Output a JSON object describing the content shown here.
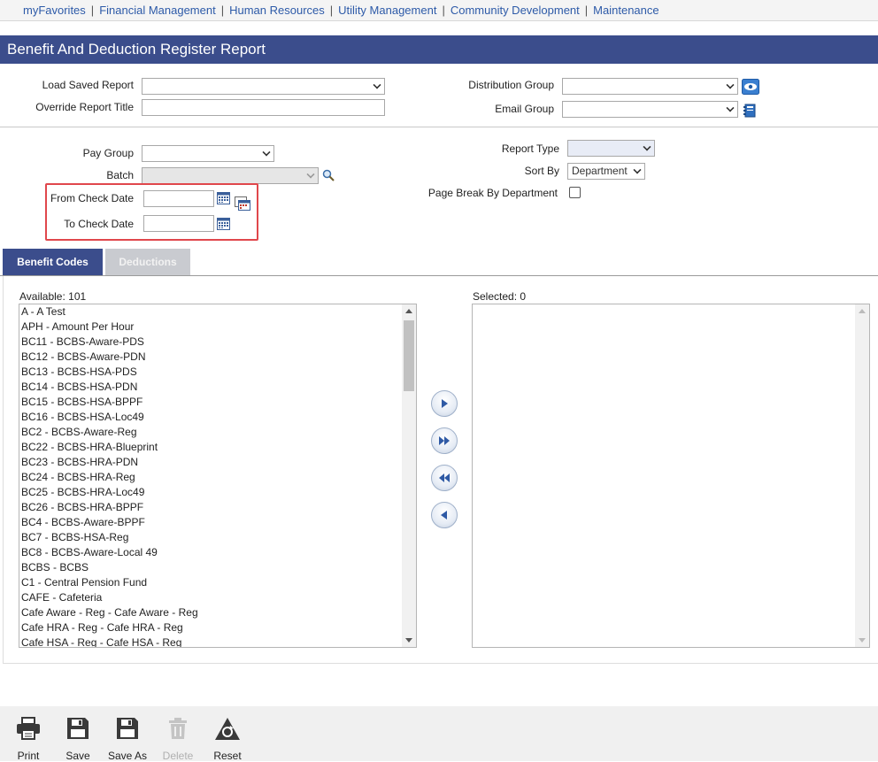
{
  "nav": {
    "items": [
      "myFavorites",
      "Financial Management",
      "Human Resources",
      "Utility Management",
      "Community Development",
      "Maintenance"
    ],
    "separator": "|"
  },
  "page": {
    "title": "Benefit And Deduction Register Report"
  },
  "header_form": {
    "load_saved_report": {
      "label": "Load Saved Report",
      "value": ""
    },
    "override_report_title": {
      "label": "Override Report Title",
      "value": ""
    },
    "distribution_group": {
      "label": "Distribution Group",
      "value": ""
    },
    "email_group": {
      "label": "Email Group",
      "value": ""
    }
  },
  "criteria": {
    "pay_group": {
      "label": "Pay Group",
      "value": ""
    },
    "batch": {
      "label": "Batch",
      "value": ""
    },
    "from_check_date": {
      "label": "From Check Date",
      "value": ""
    },
    "to_check_date": {
      "label": "To Check Date",
      "value": ""
    },
    "report_type": {
      "label": "Report Type",
      "value": ""
    },
    "sort_by": {
      "label": "Sort By",
      "value": "Department"
    },
    "page_break": {
      "label": "Page Break By Department",
      "checked": false
    }
  },
  "tabs": [
    {
      "label": "Benefit Codes",
      "active": true
    },
    {
      "label": "Deductions",
      "active": false
    }
  ],
  "available": {
    "label": "Available: 101",
    "items": [
      "A - A Test",
      "APH - Amount Per Hour",
      "BC11 - BCBS-Aware-PDS",
      "BC12 - BCBS-Aware-PDN",
      "BC13 - BCBS-HSA-PDS",
      "BC14 - BCBS-HSA-PDN",
      "BC15 - BCBS-HSA-BPPF",
      "BC16 - BCBS-HSA-Loc49",
      "BC2 - BCBS-Aware-Reg",
      "BC22 - BCBS-HRA-Blueprint",
      "BC23 - BCBS-HRA-PDN",
      "BC24 - BCBS-HRA-Reg",
      "BC25 - BCBS-HRA-Loc49",
      "BC26 - BCBS-HRA-BPPF",
      "BC4 - BCBS-Aware-BPPF",
      "BC7 - BCBS-HSA-Reg",
      "BC8 - BCBS-Aware-Local 49",
      "BCBS - BCBS",
      "C1 - Central Pension Fund",
      "CAFE - Cafeteria",
      "Cafe Aware - Reg - Cafe Aware - Reg",
      "Cafe HRA - Reg - Cafe HRA - Reg",
      "Cafe HSA - Reg - Cafe HSA - Reg"
    ]
  },
  "selected": {
    "label": "Selected: 0",
    "items": []
  },
  "footer": {
    "print": "Print",
    "save": "Save",
    "save_as": "Save As",
    "delete": "Delete",
    "reset": "Reset"
  },
  "colors": {
    "title_bar": "#3b4d8c",
    "nav_link": "#2d5aa8",
    "highlight_box": "#e0474c"
  }
}
